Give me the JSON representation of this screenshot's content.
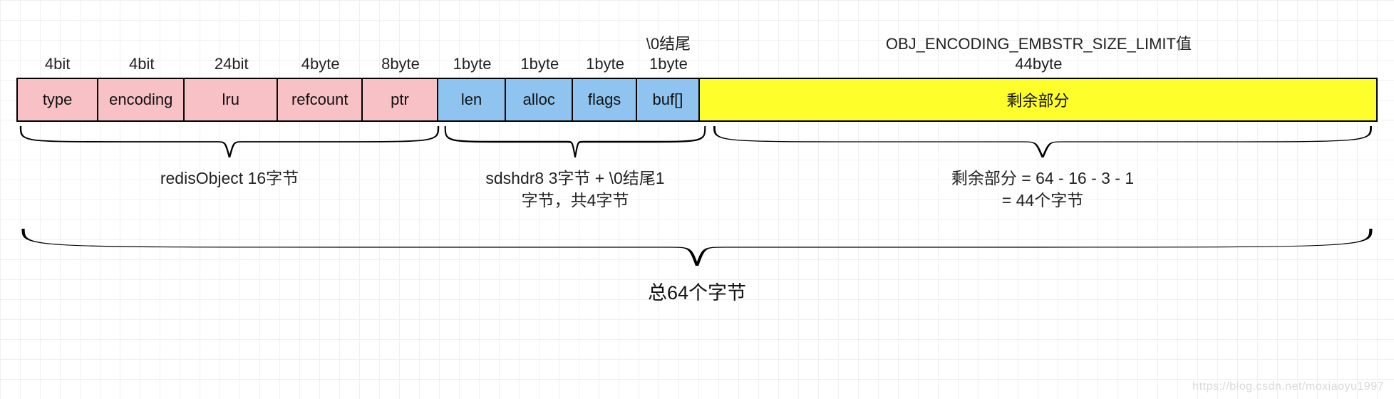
{
  "columns": [
    {
      "id": "type",
      "size": "4bit",
      "label": "type",
      "color": "pink",
      "wclass": "w-type"
    },
    {
      "id": "encoding",
      "size": "4bit",
      "label": "encoding",
      "color": "pink",
      "wclass": "w-encoding"
    },
    {
      "id": "lru",
      "size": "24bit",
      "label": "lru",
      "color": "pink",
      "wclass": "w-lru"
    },
    {
      "id": "refcount",
      "size": "4byte",
      "label": "refcount",
      "color": "pink",
      "wclass": "w-refcount"
    },
    {
      "id": "ptr",
      "size": "8byte",
      "label": "ptr",
      "color": "pink",
      "wclass": "w-ptr"
    },
    {
      "id": "len",
      "size": "1byte",
      "label": "len",
      "color": "blue",
      "wclass": "w-len"
    },
    {
      "id": "alloc",
      "size": "1byte",
      "label": "alloc",
      "color": "blue",
      "wclass": "w-alloc"
    },
    {
      "id": "flags",
      "size": "1byte",
      "label": "flags",
      "color": "blue",
      "wclass": "w-flags"
    },
    {
      "id": "buf",
      "size_pre": "\\0结尾",
      "size": "1byte",
      "label": "buf[]",
      "color": "blue",
      "wclass": "w-buf"
    },
    {
      "id": "rest",
      "size_pre": "OBJ_ENCODING_EMBSTR_SIZE_LIMIT值",
      "size": "44byte",
      "label": "剩余部分",
      "color": "yellow",
      "wclass": "w-rest"
    }
  ],
  "braces": {
    "g1": "redisObject 16字节",
    "g2_l1": "sdshdr8 3字节 + \\0结尾1",
    "g2_l2": "字节，共4字节",
    "g3_l1": "剩余部分 = 64 - 16 - 3 - 1",
    "g3_l2": "= 44个字节"
  },
  "total": "总64个字节",
  "watermark": "https://blog.csdn.net/moxiaoyu1997"
}
